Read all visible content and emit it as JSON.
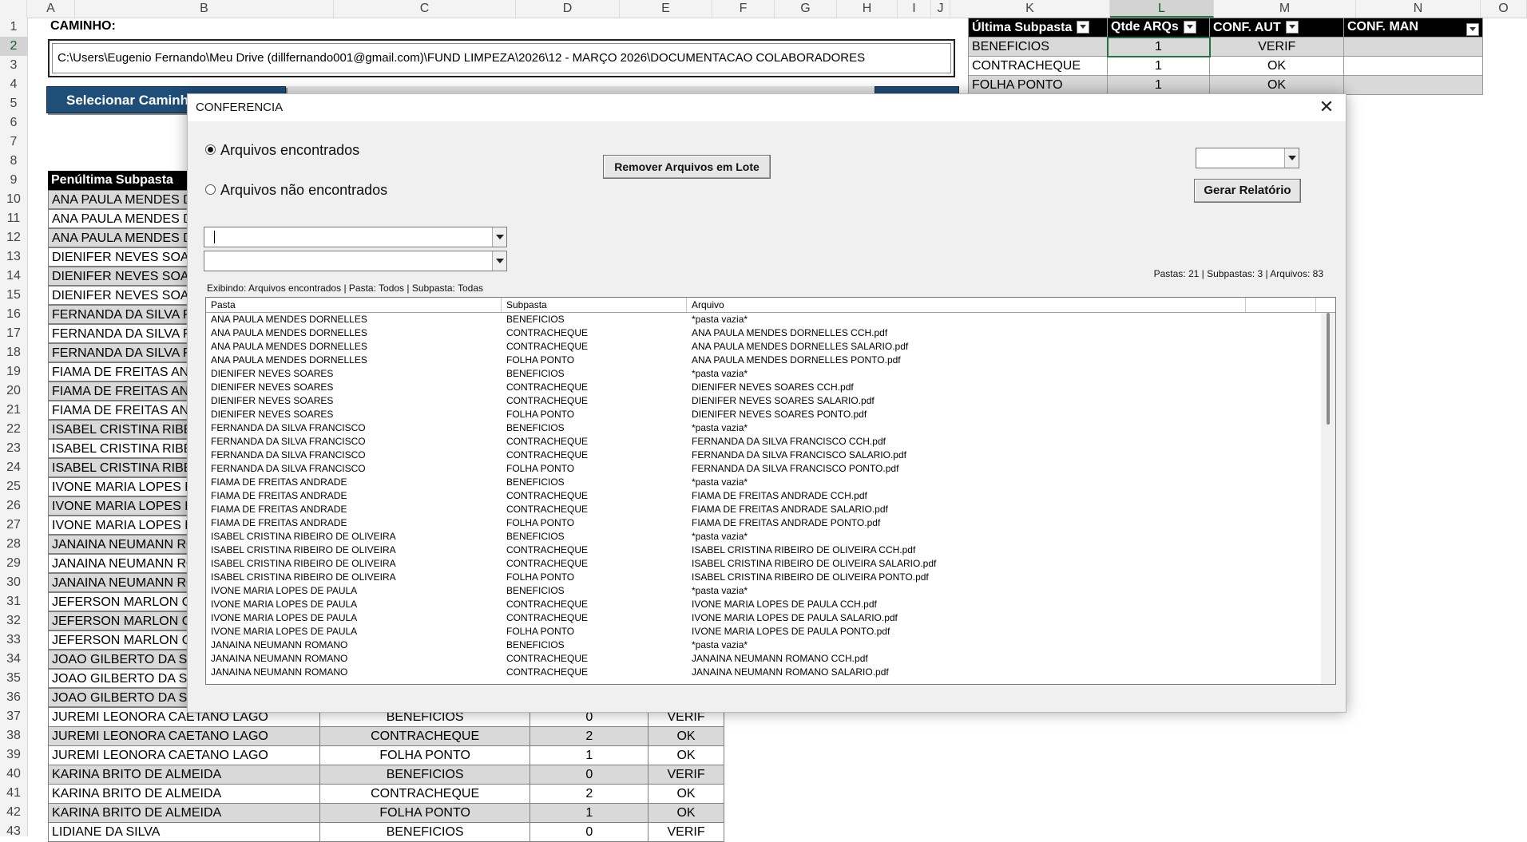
{
  "sheet": {
    "columns": [
      "A",
      "B",
      "C",
      "D",
      "E",
      "F",
      "G",
      "H",
      "I",
      "J",
      "K",
      "L",
      "M",
      "N",
      "O"
    ],
    "selected_column": "L",
    "selected_row": "2",
    "rows": [
      "1",
      "2",
      "3",
      "4",
      "5",
      "6",
      "7",
      "8",
      "9",
      "10",
      "11",
      "12",
      "13",
      "14",
      "15",
      "16",
      "17",
      "18",
      "19",
      "20",
      "21",
      "22",
      "23",
      "24",
      "25",
      "26",
      "27",
      "28",
      "29",
      "30",
      "31",
      "32",
      "33",
      "34",
      "35",
      "36",
      "37",
      "38",
      "39",
      "40",
      "41",
      "42",
      "43"
    ],
    "caminho_label": "CAMINHO:",
    "path_value": "C:\\Users\\Eugenio Fernando\\Meu Drive (dillfernando001@gmail.com)\\FUND LIMPEZA\\2026\\12 - MARÇO 2026\\DOCUMENTACAO COLABORADORES",
    "select_button_label": "Selecionar Caminho",
    "penultima_header": "Penúltima Subpasta",
    "names_left": [
      "ANA PAULA MENDES DORNELLES",
      "ANA PAULA MENDES DORNELLES",
      "ANA PAULA MENDES DORNELLES",
      "DIENIFER NEVES SOARES",
      "DIENIFER NEVES SOARES",
      "DIENIFER NEVES SOARES",
      "FERNANDA DA SILVA FRANCISCO",
      "FERNANDA DA SILVA FRANCISCO",
      "FERNANDA DA SILVA FRANCISCO",
      "FIAMA DE FREITAS ANDRADE",
      "FIAMA DE FREITAS ANDRADE",
      "FIAMA DE FREITAS ANDRADE",
      "ISABEL CRISTINA RIBEIRO DE OLIVEIRA",
      "ISABEL CRISTINA RIBEIRO DE OLIVEIRA",
      "ISABEL CRISTINA RIBEIRO DE OLIVEIRA",
      "IVONE MARIA LOPES DE PAULA",
      "IVONE MARIA LOPES DE PAULA",
      "IVONE MARIA LOPES DE PAULA",
      "JANAINA NEUMANN ROMANO",
      "JANAINA NEUMANN ROMANO",
      "JANAINA NEUMANN ROMANO",
      "JEFERSON MARLON OLIVEIRA",
      "JEFERSON MARLON OLIVEIRA",
      "JEFERSON MARLON OLIVEIRA",
      "JOAO GILBERTO DA SILVA",
      "JOAO GILBERTO DA SILVA",
      "JOAO GILBERTO DA SILVA"
    ],
    "lower_rows": [
      {
        "name": "JUREMI LEONORA CAETANO LAGO",
        "sub": "BENEFICIOS",
        "qtd": "0",
        "conf": "VERIF"
      },
      {
        "name": "JUREMI LEONORA CAETANO LAGO",
        "sub": "CONTRACHEQUE",
        "qtd": "2",
        "conf": "OK"
      },
      {
        "name": "JUREMI LEONORA CAETANO LAGO",
        "sub": "FOLHA PONTO",
        "qtd": "1",
        "conf": "OK"
      },
      {
        "name": "KARINA BRITO DE ALMEIDA",
        "sub": "BENEFICIOS",
        "qtd": "0",
        "conf": "VERIF"
      },
      {
        "name": "KARINA BRITO DE ALMEIDA",
        "sub": "CONTRACHEQUE",
        "qtd": "2",
        "conf": "OK"
      },
      {
        "name": "KARINA BRITO DE ALMEIDA",
        "sub": "FOLHA PONTO",
        "qtd": "1",
        "conf": "OK"
      },
      {
        "name": "LIDIANE DA SILVA",
        "sub": "BENEFICIOS",
        "qtd": "0",
        "conf": "VERIF"
      }
    ],
    "right_table": {
      "headers": [
        "Última Subpasta",
        "Qtde ARQs",
        "CONF. AUT",
        "CONF. MAN"
      ],
      "rows": [
        {
          "sub": "BENEFICIOS",
          "qtd": "1",
          "aut": "VERIF",
          "man": ""
        },
        {
          "sub": "CONTRACHEQUE",
          "qtd": "1",
          "aut": "OK",
          "man": ""
        },
        {
          "sub": "FOLHA PONTO",
          "qtd": "1",
          "aut": "OK",
          "man": ""
        }
      ]
    }
  },
  "dialog": {
    "title": "CONFERENCIA",
    "radio_found": "Arquivos encontrados",
    "radio_not_found": "Arquivos não encontrados",
    "remove_button": "Remover Arquivos em Lote",
    "report_button": "Gerar Relatório",
    "status_left": "Exibindo: Arquivos encontrados | Pasta: Todos | Subpasta: Todas",
    "status_right": "Pastas: 21 | Subpastas: 3 | Arquivos: 83",
    "list_headers": [
      "Pasta",
      "Subpasta",
      "Arquivo"
    ],
    "list_rows": [
      [
        "ANA PAULA MENDES DORNELLES",
        "BENEFICIOS",
        "*pasta vazia*"
      ],
      [
        "ANA PAULA MENDES DORNELLES",
        "CONTRACHEQUE",
        "ANA PAULA MENDES DORNELLES CCH.pdf"
      ],
      [
        "ANA PAULA MENDES DORNELLES",
        "CONTRACHEQUE",
        "ANA PAULA MENDES DORNELLES SALARIO.pdf"
      ],
      [
        "ANA PAULA MENDES DORNELLES",
        "FOLHA PONTO",
        "ANA PAULA MENDES DORNELLES PONTO.pdf"
      ],
      [
        "DIENIFER NEVES SOARES",
        "BENEFICIOS",
        "*pasta vazia*"
      ],
      [
        "DIENIFER NEVES SOARES",
        "CONTRACHEQUE",
        "DIENIFER NEVES SOARES CCH.pdf"
      ],
      [
        "DIENIFER NEVES SOARES",
        "CONTRACHEQUE",
        "DIENIFER NEVES SOARES SALARIO.pdf"
      ],
      [
        "DIENIFER NEVES SOARES",
        "FOLHA PONTO",
        "DIENIFER NEVES SOARES PONTO.pdf"
      ],
      [
        "FERNANDA DA SILVA FRANCISCO",
        "BENEFICIOS",
        "*pasta vazia*"
      ],
      [
        "FERNANDA DA SILVA FRANCISCO",
        "CONTRACHEQUE",
        "FERNANDA DA SILVA FRANCISCO CCH.pdf"
      ],
      [
        "FERNANDA DA SILVA FRANCISCO",
        "CONTRACHEQUE",
        "FERNANDA DA SILVA FRANCISCO SALARIO.pdf"
      ],
      [
        "FERNANDA DA SILVA FRANCISCO",
        "FOLHA PONTO",
        "FERNANDA DA SILVA FRANCISCO PONTO.pdf"
      ],
      [
        "FIAMA DE FREITAS ANDRADE",
        "BENEFICIOS",
        "*pasta vazia*"
      ],
      [
        "FIAMA DE FREITAS ANDRADE",
        "CONTRACHEQUE",
        "FIAMA DE FREITAS ANDRADE CCH.pdf"
      ],
      [
        "FIAMA DE FREITAS ANDRADE",
        "CONTRACHEQUE",
        "FIAMA DE FREITAS ANDRADE SALARIO.pdf"
      ],
      [
        "FIAMA DE FREITAS ANDRADE",
        "FOLHA PONTO",
        "FIAMA DE FREITAS ANDRADE PONTO.pdf"
      ],
      [
        "ISABEL CRISTINA RIBEIRO DE OLIVEIRA",
        "BENEFICIOS",
        "*pasta vazia*"
      ],
      [
        "ISABEL CRISTINA RIBEIRO DE OLIVEIRA",
        "CONTRACHEQUE",
        "ISABEL CRISTINA RIBEIRO DE OLIVEIRA CCH.pdf"
      ],
      [
        "ISABEL CRISTINA RIBEIRO DE OLIVEIRA",
        "CONTRACHEQUE",
        "ISABEL CRISTINA RIBEIRO DE OLIVEIRA SALARIO.pdf"
      ],
      [
        "ISABEL CRISTINA RIBEIRO DE OLIVEIRA",
        "FOLHA PONTO",
        "ISABEL CRISTINA RIBEIRO DE OLIVEIRA PONTO.pdf"
      ],
      [
        "IVONE MARIA LOPES DE PAULA",
        "BENEFICIOS",
        "*pasta vazia*"
      ],
      [
        "IVONE MARIA LOPES DE PAULA",
        "CONTRACHEQUE",
        "IVONE MARIA LOPES DE PAULA CCH.pdf"
      ],
      [
        "IVONE MARIA LOPES DE PAULA",
        "CONTRACHEQUE",
        "IVONE MARIA LOPES DE PAULA SALARIO.pdf"
      ],
      [
        "IVONE MARIA LOPES DE PAULA",
        "FOLHA PONTO",
        "IVONE MARIA LOPES DE PAULA PONTO.pdf"
      ],
      [
        "JANAINA NEUMANN ROMANO",
        "BENEFICIOS",
        "*pasta vazia*"
      ],
      [
        "JANAINA NEUMANN ROMANO",
        "CONTRACHEQUE",
        "JANAINA NEUMANN ROMANO CCH.pdf"
      ],
      [
        "JANAINA NEUMANN ROMANO",
        "CONTRACHEQUE",
        "JANAINA NEUMANN ROMANO SALARIO.pdf"
      ]
    ]
  }
}
